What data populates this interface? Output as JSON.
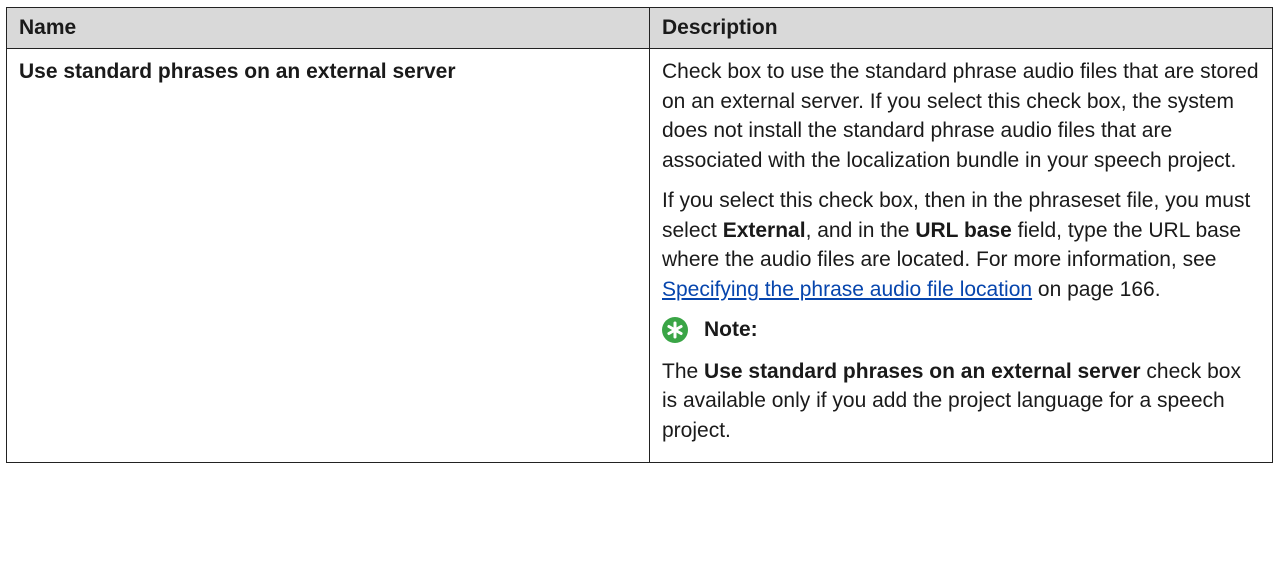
{
  "table": {
    "headers": {
      "name": "Name",
      "description": "Description"
    },
    "row": {
      "name": "Use standard phrases on an external server",
      "para1": "Check box to use the standard phrase audio files that are stored on an external server. If you select this check box, the system does not install the standard phrase audio files that are associated with the localization bundle in your speech project.",
      "para2": {
        "t1": "If you select this check box, then in the phraseset file, you must select ",
        "b1": "External",
        "t2": ", and in the ",
        "b2": "URL base",
        "t3": " field, type the URL base where the audio files are located. For more information, see ",
        "link": "Specifying the phrase audio file location",
        "t4": " on page 166."
      },
      "note": {
        "icon": "note-star-icon",
        "label": "Note:",
        "t1": "The ",
        "b1": "Use standard phrases on an external server",
        "t2": " check box is available only if you add the project language for a speech project."
      }
    }
  },
  "colors": {
    "header_bg": "#d9d9d9",
    "border": "#222222",
    "link": "#0645ad",
    "note_icon": "#3aa546"
  }
}
